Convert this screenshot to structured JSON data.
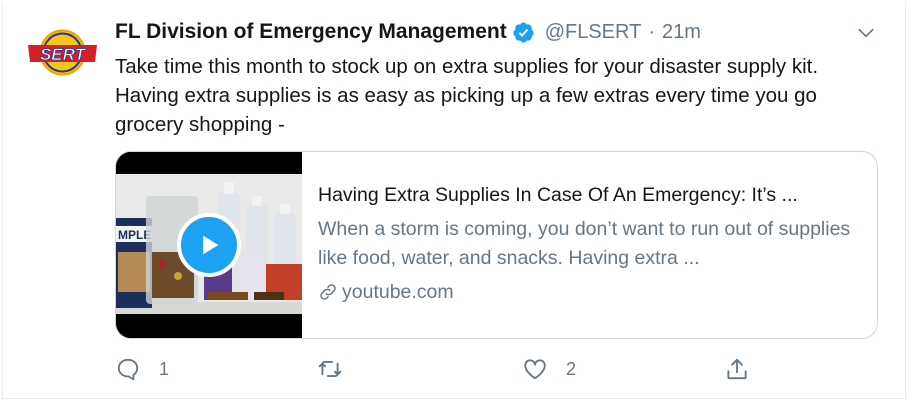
{
  "tweet": {
    "author_name": "FL Division of Emergency Management",
    "handle": "@FLSERT",
    "separator": "·",
    "time": "21m",
    "text": "Take time this month to stock up on extra supplies for your disaster supply kit. Having extra supplies is as easy as picking up a few extras every time you go grocery shopping -"
  },
  "avatar": {
    "logo_text": "SERT"
  },
  "card": {
    "title": "Having Extra Supplies In Case Of An Emergency: It’s ...",
    "description": "When a storm is coming, you don’t want to run out of supplies like food, water, and snacks. Having extra ...",
    "domain": "youtube.com",
    "thumbnail_label": "MPLE"
  },
  "actions": {
    "reply_count": "1",
    "retweet_count": "",
    "like_count": "2"
  },
  "icons": {
    "verified": "verified-badge-icon",
    "caret": "chevron-down-icon",
    "play": "play-icon",
    "link": "link-icon",
    "reply": "reply-icon",
    "retweet": "retweet-icon",
    "like": "heart-icon",
    "share": "share-icon"
  },
  "colors": {
    "accent": "#1da1f2",
    "text": "#14171a",
    "secondary": "#657786",
    "border": "#ccd6dd"
  }
}
